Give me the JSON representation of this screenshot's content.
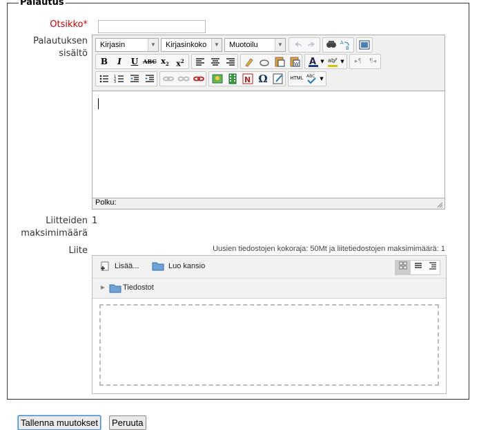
{
  "legend": "Palautus",
  "labels": {
    "otsikko": "Otsikko",
    "required_mark": "*",
    "content_1": "Palautuksen",
    "content_2": "sisältö",
    "max_attach_1": "Liitteiden",
    "max_attach_2": "maksimimäärä",
    "attachment": "Liite"
  },
  "title_input": {
    "value": ""
  },
  "editor": {
    "font_family": "Kirjasin",
    "font_size": "Kirjasinkoko",
    "format": "Muotoilu",
    "path_label": "Polku:"
  },
  "max_attachments_value": "1",
  "quota_text": "Uusien tiedostojen kokoraja: 50Mt ja liitetiedostojen maksimimäärä: 1",
  "filepicker": {
    "add_label": "Lisää...",
    "new_folder_label": "Luo kansio",
    "folder_label": "Tiedostot"
  },
  "buttons": {
    "save": "Tallenna muutokset",
    "cancel": "Peruuta"
  }
}
